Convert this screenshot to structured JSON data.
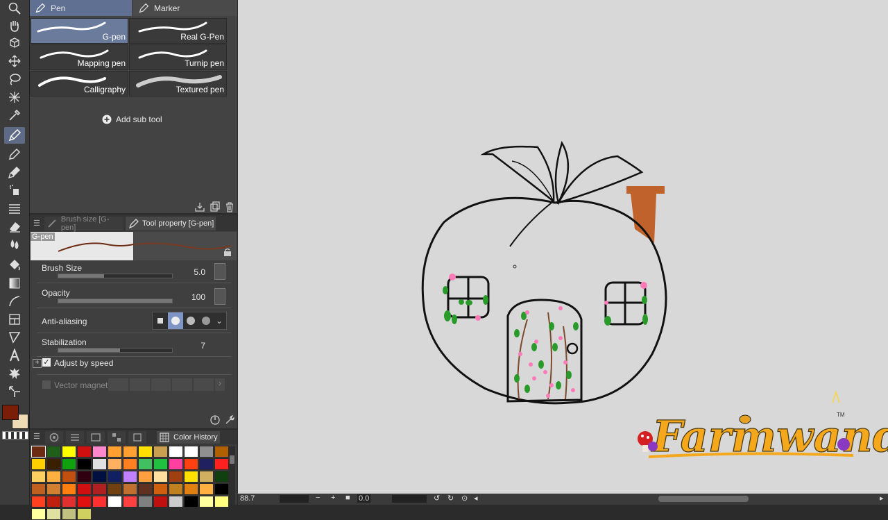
{
  "subtool": {
    "tabs": [
      {
        "label": "Pen"
      },
      {
        "label": "Marker"
      }
    ],
    "brushes": [
      {
        "label": "G-pen"
      },
      {
        "label": "Real G-Pen"
      },
      {
        "label": "Mapping pen"
      },
      {
        "label": "Turnip pen"
      },
      {
        "label": "Calligraphy"
      },
      {
        "label": "Textured pen"
      }
    ],
    "add_label": "Add sub tool"
  },
  "toolprop": {
    "tabs": [
      {
        "label": "Brush size [G-pen]"
      },
      {
        "label": "Tool property [G-pen]"
      }
    ],
    "preview_name": "G-pen",
    "brush_size": {
      "label": "Brush Size",
      "value": "5.0",
      "level": 0.4
    },
    "opacity": {
      "label": "Opacity",
      "value": "100",
      "level": 1.0
    },
    "anti_aliasing": {
      "label": "Anti-aliasing"
    },
    "stabilization": {
      "label": "Stabilization",
      "value": "7",
      "level": 0.54
    },
    "adjust_by_speed": {
      "label": "Adjust by speed",
      "checked": true
    },
    "vector_magnet": {
      "label": "Vector magnet"
    }
  },
  "colorpanel": {
    "tab_label": "Color History",
    "colors": [
      "#6b2a12",
      "#1f5f1a",
      "#ffff00",
      "#d01010",
      "#ff88cc",
      "#ffa030",
      "#ffa030",
      "#ffe000",
      "#c8a050",
      "#ffffff",
      "#ffffff",
      "#909090",
      "#b06000",
      "#ffd000",
      "#3a2000",
      "#10a010",
      "#000000",
      "#e0e0e0",
      "#ffb060",
      "#ff8020",
      "#40c060",
      "#20c040",
      "#ff40a0",
      "#ff4010",
      "#202060",
      "#ff2020",
      "#ffd060",
      "#ffb040",
      "#c05010",
      "#300010",
      "#001040",
      "#102060",
      "#c080ff",
      "#ffa040",
      "#ffe0a0",
      "#a04010",
      "#ffe000",
      "#d0b060",
      "#104010",
      "#c06020",
      "#d08030",
      "#ff8010",
      "#d01010",
      "#b02020",
      "#704010",
      "#c07030",
      "#603020",
      "#d06010",
      "#c08020",
      "#e08010",
      "#ffb040",
      "#000000",
      "#ff4020",
      "#c02010",
      "#e03030",
      "#e01010",
      "#ff3030",
      "#ffffff",
      "#ff4040",
      "#808080",
      "#c01010",
      "#cccccc",
      "#000000",
      "#ffffa0",
      "#ffff80",
      "#ffffa0",
      "#e0e0a0",
      "#c0c080",
      "#d0d060"
    ]
  },
  "canvas": {
    "zoom": "88.7",
    "rotation": "0.0",
    "logo_text": "Farmwand",
    "tm": "TM"
  },
  "colors": {
    "main_color": "#7a1e08",
    "sub_color": "#f0dcb4",
    "accent": "#6a7b9c",
    "chimney": "#c0622c",
    "logo_orange": "#f5a81c"
  }
}
